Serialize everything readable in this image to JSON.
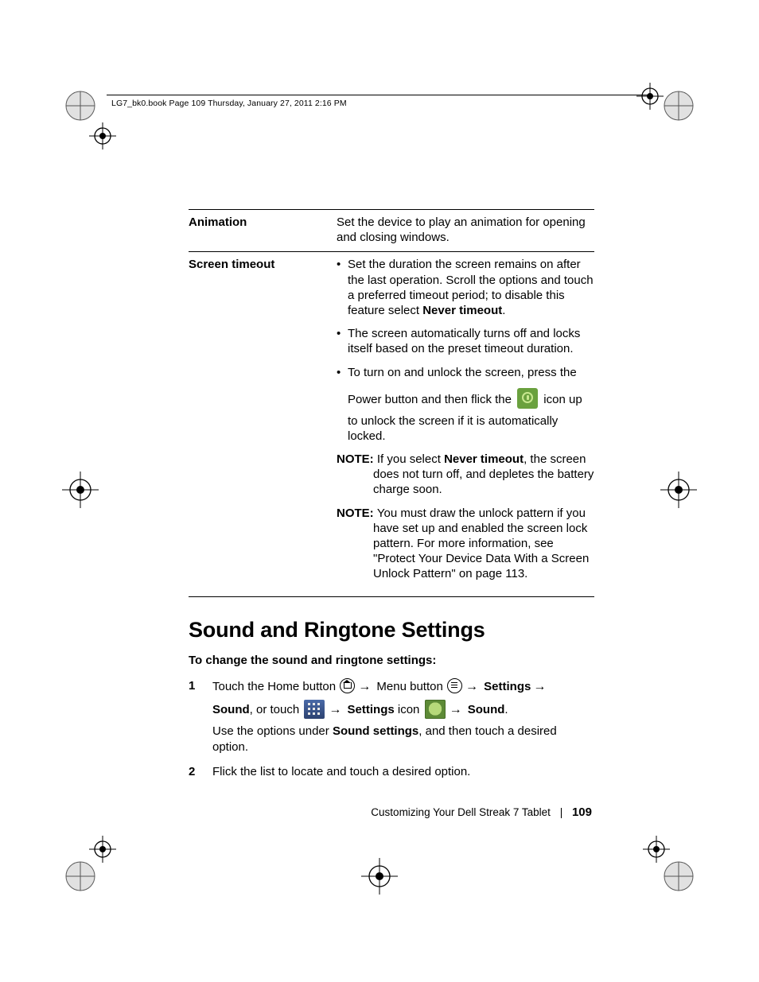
{
  "header": "LG7_bk0.book  Page 109  Thursday, January 27, 2011  2:16 PM",
  "table": {
    "row1": {
      "label": "Animation",
      "desc": "Set the device to play an animation for opening and closing windows."
    },
    "row2": {
      "label": "Screen timeout",
      "b1a": "Set the duration the screen remains on after the last operation. Scroll the options and touch a preferred timeout period; to disable this feature select ",
      "b1bold": "Never timeout",
      "b1b": ".",
      "b2": "The screen automatically turns off and locks itself based on the preset timeout duration.",
      "b3a": "To turn on and unlock the screen, press the",
      "b3b": "Power button and then flick the ",
      "b3c": " icon up",
      "b3d": "to unlock the screen if it is automatically locked.",
      "note1_label": "NOTE: ",
      "note1_a": "If you select ",
      "note1_bold": "Never timeout",
      "note1_b": ", the screen ",
      "note1_c": "does not turn off, and depletes the battery charge soon.",
      "note2_label": "NOTE: ",
      "note2_a": "You must draw the unlock pattern if you ",
      "note2_b": "have set up and enabled the screen lock pattern. For more information, see \"Protect Your Device Data With a Screen Unlock Pattern\" on page 113."
    }
  },
  "heading": "Sound and Ringtone Settings",
  "subheading": "To change the sound and ringtone settings:",
  "steps": {
    "s1": {
      "num": "1",
      "t1": "Touch the Home button ",
      "t2": " Menu button ",
      "bold1": "Settings",
      "bold2": "Sound",
      "t3": ", or touch ",
      "bold3": "Settings",
      "t4": " icon ",
      "bold4": "Sound",
      "t5": ".",
      "t6": "Use the options under ",
      "bold5": "Sound settings",
      "t7": ", and then touch a desired option."
    },
    "s2": {
      "num": "2",
      "text": "Flick the list to locate and touch a desired option."
    }
  },
  "footer": {
    "chapter": "Customizing Your Dell Streak 7 Tablet",
    "page": "109",
    "sep": "|"
  }
}
